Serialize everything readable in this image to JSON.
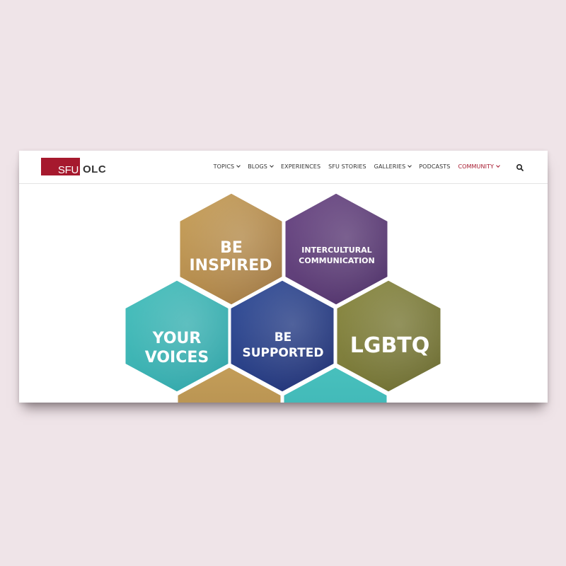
{
  "logo": {
    "sfu": "SFU",
    "olc": "OLC"
  },
  "nav": {
    "items": [
      {
        "label": "TOPICS",
        "dropdown": true,
        "active": false
      },
      {
        "label": "BLOGS",
        "dropdown": true,
        "active": false
      },
      {
        "label": "EXPERIENCES",
        "dropdown": false,
        "active": false
      },
      {
        "label": "SFU STORIES",
        "dropdown": false,
        "active": false
      },
      {
        "label": "GALLERIES",
        "dropdown": true,
        "active": false
      },
      {
        "label": "PODCASTS",
        "dropdown": false,
        "active": false
      },
      {
        "label": "COMMUNITY",
        "dropdown": true,
        "active": true
      }
    ],
    "search_icon": "search-icon"
  },
  "hero": {
    "tiles": [
      {
        "id": "be-inspired",
        "lines": [
          "BE",
          "INSPIRED"
        ],
        "color": "#b8924e"
      },
      {
        "id": "intercultural-communication",
        "lines": [
          "INTERCULTURAL",
          "COMMUNICATION"
        ],
        "color": "#5e3c7a"
      },
      {
        "id": "your-voices",
        "lines": [
          "YOUR",
          "VOICES"
        ],
        "color": "#3fb4b4"
      },
      {
        "id": "be-supported",
        "lines": [
          "BE",
          "SUPPORTED"
        ],
        "color": "#2c3f86"
      },
      {
        "id": "lgbtq",
        "lines": [
          "LGBTQ"
        ],
        "color": "#7e7d3a"
      }
    ]
  },
  "colors": {
    "brand_red": "#a6192e",
    "background": "#efe4e8"
  }
}
